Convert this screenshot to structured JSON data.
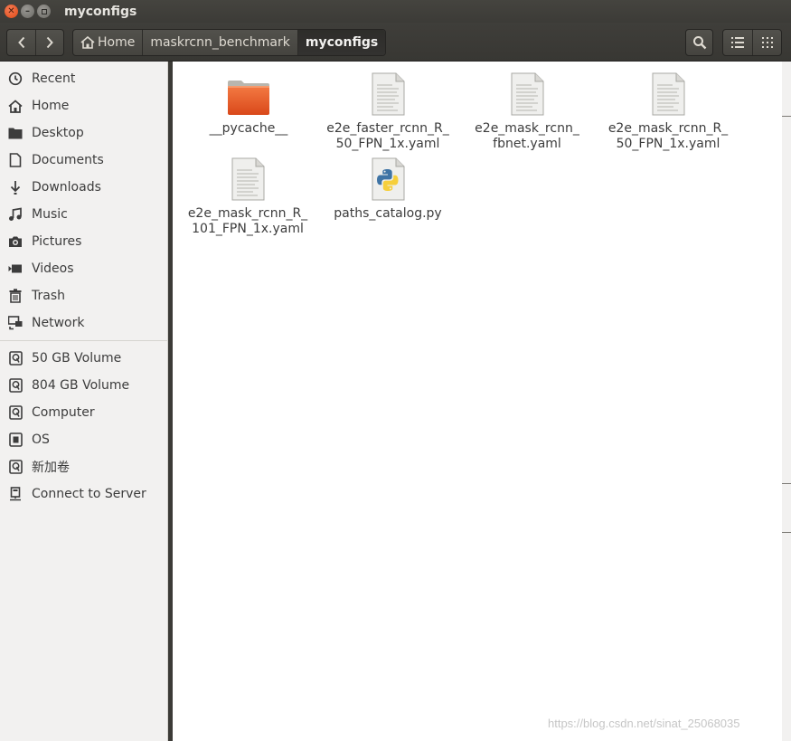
{
  "window": {
    "title": "myconfigs"
  },
  "pathbar": {
    "crumbs": [
      "Home",
      "maskrcnn_benchmark",
      "myconfigs"
    ]
  },
  "sidebar": {
    "places": [
      {
        "label": "Recent",
        "icon": "clock-icon"
      },
      {
        "label": "Home",
        "icon": "home-icon"
      },
      {
        "label": "Desktop",
        "icon": "folder-icon"
      },
      {
        "label": "Documents",
        "icon": "document-icon"
      },
      {
        "label": "Downloads",
        "icon": "download-icon"
      },
      {
        "label": "Music",
        "icon": "music-icon"
      },
      {
        "label": "Pictures",
        "icon": "camera-icon"
      },
      {
        "label": "Videos",
        "icon": "video-icon"
      },
      {
        "label": "Trash",
        "icon": "trash-icon"
      },
      {
        "label": "Network",
        "icon": "network-icon"
      }
    ],
    "devices": [
      {
        "label": "50 GB Volume",
        "icon": "drive-icon"
      },
      {
        "label": "804 GB Volume",
        "icon": "drive-icon"
      },
      {
        "label": "Computer",
        "icon": "drive-icon"
      },
      {
        "label": "OS",
        "icon": "chip-icon"
      },
      {
        "label": "新加卷",
        "icon": "drive-icon"
      },
      {
        "label": "Connect to Server",
        "icon": "server-icon"
      }
    ]
  },
  "files": [
    {
      "name": "__pycache__",
      "type": "folder",
      "icon": "folder-icon"
    },
    {
      "name": "e2e_faster_rcnn_R_\n50_FPN_1x.yaml",
      "type": "text",
      "icon": "text-file-icon"
    },
    {
      "name": "e2e_mask_rcnn_\nfbnet.yaml",
      "type": "text",
      "icon": "text-file-icon"
    },
    {
      "name": "e2e_mask_rcnn_R_\n50_FPN_1x.yaml",
      "type": "text",
      "icon": "text-file-icon"
    },
    {
      "name": "e2e_mask_rcnn_R_\n101_FPN_1x.yaml",
      "type": "text",
      "icon": "text-file-icon"
    },
    {
      "name": "paths_catalog.py",
      "type": "python",
      "icon": "python-file-icon"
    }
  ],
  "watermark": "https://blog.csdn.net/sinat_25068035",
  "colors": {
    "accent": "#e95420",
    "titlebar": "#3c3b37",
    "sidebar": "#f2f1f0"
  }
}
